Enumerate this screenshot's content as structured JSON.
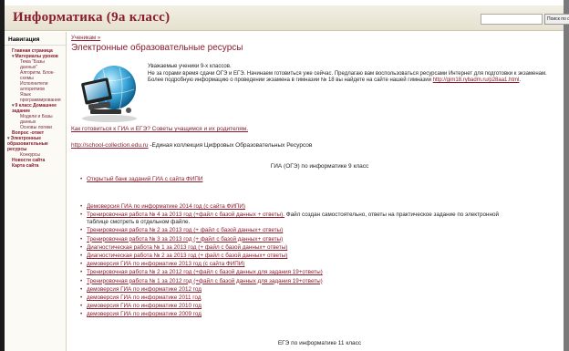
{
  "header": {
    "title": "Информатика (9а класс)",
    "search_placeholder": "",
    "search_button": "Поиск по сайту"
  },
  "sidebar": {
    "heading": "Навигация",
    "items": [
      {
        "label": "Главная страница",
        "level": "l1",
        "arrow": ""
      },
      {
        "label": "Материалы уроков",
        "level": "l1",
        "arrow": "▾"
      },
      {
        "label": "Тема \"Базы",
        "level": "l2",
        "arrow": ""
      },
      {
        "label": "данных\"",
        "level": "l2",
        "arrow": ""
      },
      {
        "label": "Алгоритм. Блок-",
        "level": "l2",
        "arrow": ""
      },
      {
        "label": "схемы",
        "level": "l2",
        "arrow": ""
      },
      {
        "label": "Исполнители",
        "level": "l2",
        "arrow": ""
      },
      {
        "label": "алгоритмов",
        "level": "l2",
        "arrow": ""
      },
      {
        "label": "Язык",
        "level": "l2",
        "arrow": ""
      },
      {
        "label": "программирования",
        "level": "l2",
        "arrow": ""
      },
      {
        "label": "9 класс Домашнее",
        "level": "l1",
        "arrow": "▾"
      },
      {
        "label": "задание",
        "level": "l1",
        "arrow": ""
      },
      {
        "label": "Модели и Базы",
        "level": "l2",
        "arrow": ""
      },
      {
        "label": "данных",
        "level": "l2",
        "arrow": ""
      },
      {
        "label": "Основы логики",
        "level": "l2",
        "arrow": ""
      },
      {
        "label": "Вопрос -ответ",
        "level": "l1",
        "arrow": ""
      },
      {
        "label": "Электронные",
        "level": "top",
        "arrow": "▾"
      },
      {
        "label": "образовательные",
        "level": "top",
        "arrow": ""
      },
      {
        "label": "ресурсы",
        "level": "top",
        "arrow": ""
      },
      {
        "label": "Конкурсы",
        "level": "l2",
        "arrow": ""
      },
      {
        "label": "Новости сайта",
        "level": "l1",
        "arrow": ""
      },
      {
        "label": "Карта сайта",
        "level": "l1",
        "arrow": ""
      }
    ]
  },
  "main": {
    "breadcrumb": "Ученикам »",
    "title": "Электронные образовательные ресурсы",
    "intro_line1": "Уважаемые ученики 9-х классов.",
    "intro_line2": "Не за горами время сдачи ОГЭ и ЕГЭ. Начинаем готовиться уже сейчас. Предлагаю вам воспользоваться ресурсами Интернет для подготовки к экзаменам. Более подробную информацию о проведении экзамена в гимназии № 18 вы найдете на сайте нашей гимназии",
    "intro_link": "http://gim18.rybadm.ru/p28aa1.html",
    "intro_end": ".",
    "prep_link": "Как готовиться к ГИА и ЕГЭ? Советы учащимся и их родителям.",
    "collection_link": "http://school-collection.edu.ru",
    "collection_text": " -Единая коллекция Цифровых Образовательных Ресурсов",
    "oge_heading": "ГИА (ОГЭ) по информатике 9 класс",
    "ege_heading": "ЕГЭ по информатике 11 класс",
    "list_one": [
      {
        "text": "Открытый банк заданий ГИА с сайта ФИПИ"
      }
    ],
    "list_two": [
      {
        "text": "Демоверсия ГИА по информатике 2014 год (с сайта ФИПИ)"
      },
      {
        "text": "Тренировочная работа № 4 за 2013 год (+файл с базой данных + ответы).",
        "note": " Файл создан самостоятельно, ответы на практическое задание по электронной",
        "cont": "таблице смотреть в отдельном файле."
      },
      {
        "text": "Тренировочная работа № 2 за 2013 год (+ файл с базой данных+ ответы)"
      },
      {
        "text": "Тренировочная работа № 3 за 2013 год (+ файл с базой данных+ ответы)"
      },
      {
        "text": "Диагностическая работа № 1 за 2013 год (+ файл с базой данных+ ответы)"
      },
      {
        "text": "Диагностическая работа № 2 за 2013 год (+ файл с базой данных+ ответы)"
      },
      {
        "text": "демоверсия ГИА по информатике 2013 год (с сайта ФИПИ)"
      },
      {
        "text": "Тренировочная работа № 2 за 2012 год (+файл с базой данных для задания 19+ответы)"
      },
      {
        "text": "Тренировочная работа № 1 за 2012 год (+файл с базой данных для задания 19+ответы)"
      },
      {
        "text": "демоверсия ГИА по информатике 2012 год"
      },
      {
        "text": "демоверсия ГИА по информатике 2011 год"
      },
      {
        "text": "демоверсия ГИА по информатике 2010 год"
      },
      {
        "text": "демоверсия ГИА по информатике 2009 год"
      }
    ]
  }
}
